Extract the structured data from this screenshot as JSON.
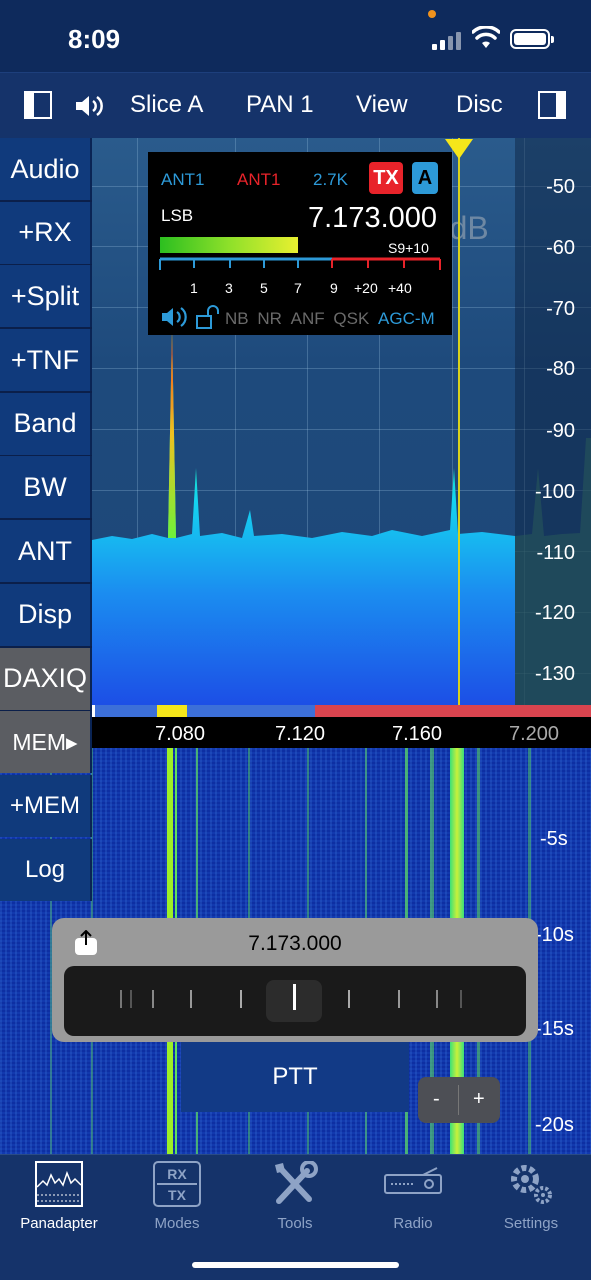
{
  "status": {
    "time": "8:09"
  },
  "toolbar": {
    "slice": "Slice A",
    "pan": "PAN 1",
    "view": "View",
    "disc": "Disc"
  },
  "sidemenu": [
    "Audio",
    "+RX",
    "+Split",
    "+TNF",
    "Band",
    "BW",
    "ANT",
    "Disp",
    "DAXIQ",
    "MEM▸",
    "+MEM",
    "Log"
  ],
  "panadapter": {
    "db_labels": [
      "-50",
      "-60",
      "-70",
      "-80",
      "-90",
      "-100",
      "-110",
      "-120",
      "-130"
    ],
    "freq_labels": [
      "7.080",
      "7.120",
      "7.160",
      "7.200"
    ],
    "ghost_db": "48dB"
  },
  "slice": {
    "rx_ant": "ANT1",
    "tx_ant": "ANT1",
    "bandwidth": "2.7K",
    "tx_badge": "TX",
    "slice_letter": "A",
    "mode": "LSB",
    "frequency": "7.173.000",
    "s_reading": "S9+10",
    "s_scale": [
      "1",
      "3",
      "5",
      "7",
      "9",
      "+20",
      "+40"
    ],
    "flags": [
      "NB",
      "NR",
      "ANF",
      "QSK",
      "AGC-M"
    ],
    "signal_level": 0.52
  },
  "waterfall": {
    "time_labels": [
      "-5s",
      "-10s",
      "-15s",
      "-20s"
    ]
  },
  "tuner": {
    "frequency": "7.173.000"
  },
  "ptt": {
    "label": "PTT",
    "minus": "-",
    "plus": "+"
  },
  "tabs": [
    {
      "label": "Panadapter",
      "icon": "panadapter-icon",
      "active": true
    },
    {
      "label": "Modes",
      "icon": "rx-tx-icon",
      "active": false
    },
    {
      "label": "Tools",
      "icon": "tools-icon",
      "active": false
    },
    {
      "label": "Radio",
      "icon": "radio-icon",
      "active": false
    },
    {
      "label": "Settings",
      "icon": "gear-icon",
      "active": false
    }
  ],
  "colors": {
    "accent_blue": "#123a86",
    "tx_red": "#e8232a",
    "spectrum_green": "#2cf020",
    "marker_yellow": "#f5e61a"
  }
}
